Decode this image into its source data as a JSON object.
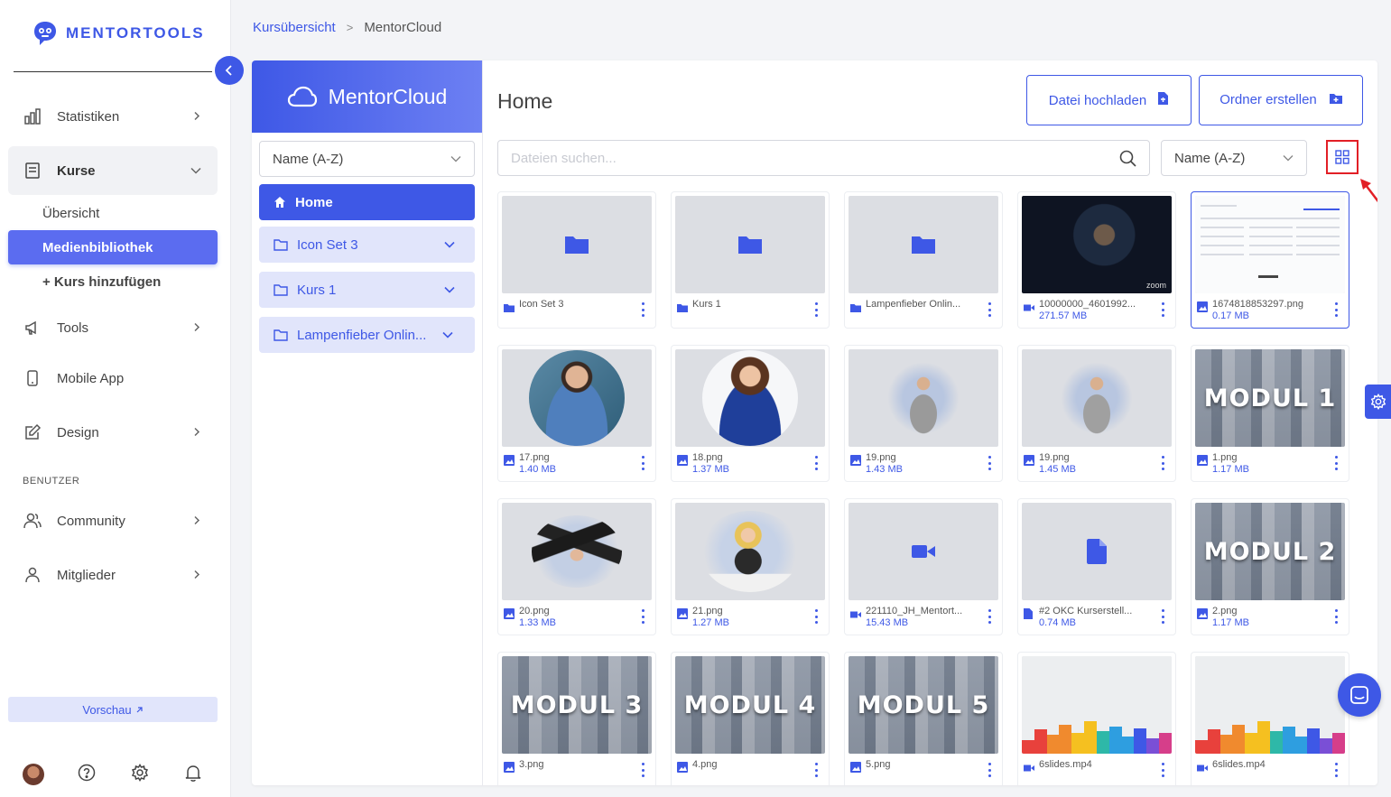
{
  "brand": {
    "name": "MENTORTOOLS",
    "accent": "#3e58e6"
  },
  "sidebar": {
    "items": [
      {
        "label": "Statistiken",
        "icon": "bar-chart-icon"
      },
      {
        "label": "Kurse",
        "icon": "book-icon"
      },
      {
        "label": "Tools",
        "icon": "megaphone-icon"
      },
      {
        "label": "Mobile App",
        "icon": "smartphone-icon"
      },
      {
        "label": "Design",
        "icon": "edit-icon"
      },
      {
        "label": "Community",
        "icon": "users-icon"
      },
      {
        "label": "Mitglieder",
        "icon": "user-icon"
      }
    ],
    "kurse_sub": [
      "Übersicht",
      "Medienbibliothek",
      "+ Kurs hinzufügen"
    ],
    "section_label": "BENUTZER",
    "preview_label": "Vorschau"
  },
  "breadcrumb": {
    "root": "Kursübersicht",
    "separator": ">",
    "current": "MentorCloud"
  },
  "tree": {
    "title": "MentorCloud",
    "sort": "Name (A-Z)",
    "nodes": [
      {
        "label": "Home"
      },
      {
        "label": "Icon Set 3"
      },
      {
        "label": "Kurs 1"
      },
      {
        "label": "Lampenfieber Onlin..."
      }
    ]
  },
  "content": {
    "title": "Home",
    "upload_label": "Datei hochladen",
    "folder_label": "Ordner erstellen",
    "search_placeholder": "Dateien suchen...",
    "sort": "Name (A-Z)"
  },
  "files": [
    {
      "name": "Icon Set 3",
      "size": "",
      "type": "folder"
    },
    {
      "name": "Kurs 1",
      "size": "",
      "type": "folder"
    },
    {
      "name": "Lampenfieber Onlin...",
      "size": "",
      "type": "folder"
    },
    {
      "name": "10000000_4601992...",
      "size": "271.57 MB",
      "type": "video"
    },
    {
      "name": "1674818853297.png",
      "size": "0.17 MB",
      "type": "image"
    },
    {
      "name": "17.png",
      "size": "1.40 MB",
      "type": "image"
    },
    {
      "name": "18.png",
      "size": "1.37 MB",
      "type": "image"
    },
    {
      "name": "19.png",
      "size": "1.43 MB",
      "type": "image"
    },
    {
      "name": "19.png",
      "size": "1.45 MB",
      "type": "image"
    },
    {
      "name": "1.png",
      "size": "1.17 MB",
      "type": "image"
    },
    {
      "name": "20.png",
      "size": "1.33 MB",
      "type": "image"
    },
    {
      "name": "21.png",
      "size": "1.27 MB",
      "type": "image"
    },
    {
      "name": "221110_JH_Mentort...",
      "size": "15.43 MB",
      "type": "video"
    },
    {
      "name": "#2 OKC Kurserstell...",
      "size": "0.74 MB",
      "type": "document"
    },
    {
      "name": "2.png",
      "size": "1.17 MB",
      "type": "image"
    },
    {
      "name": "3.png",
      "size": "",
      "type": "image"
    },
    {
      "name": "4.png",
      "size": "",
      "type": "image"
    },
    {
      "name": "5.png",
      "size": "",
      "type": "image"
    },
    {
      "name": "6slides.mp4",
      "size": "",
      "type": "video"
    },
    {
      "name": "6slides.mp4",
      "size": "",
      "type": "video"
    }
  ],
  "thumb_text": {
    "modul_1": "MODUL 1",
    "modul_2": "MODUL 2",
    "modul_3": "MODUL 3",
    "modul_4": "MODUL 4",
    "modul_5": "MODUL 5",
    "zoom": "zoom"
  }
}
